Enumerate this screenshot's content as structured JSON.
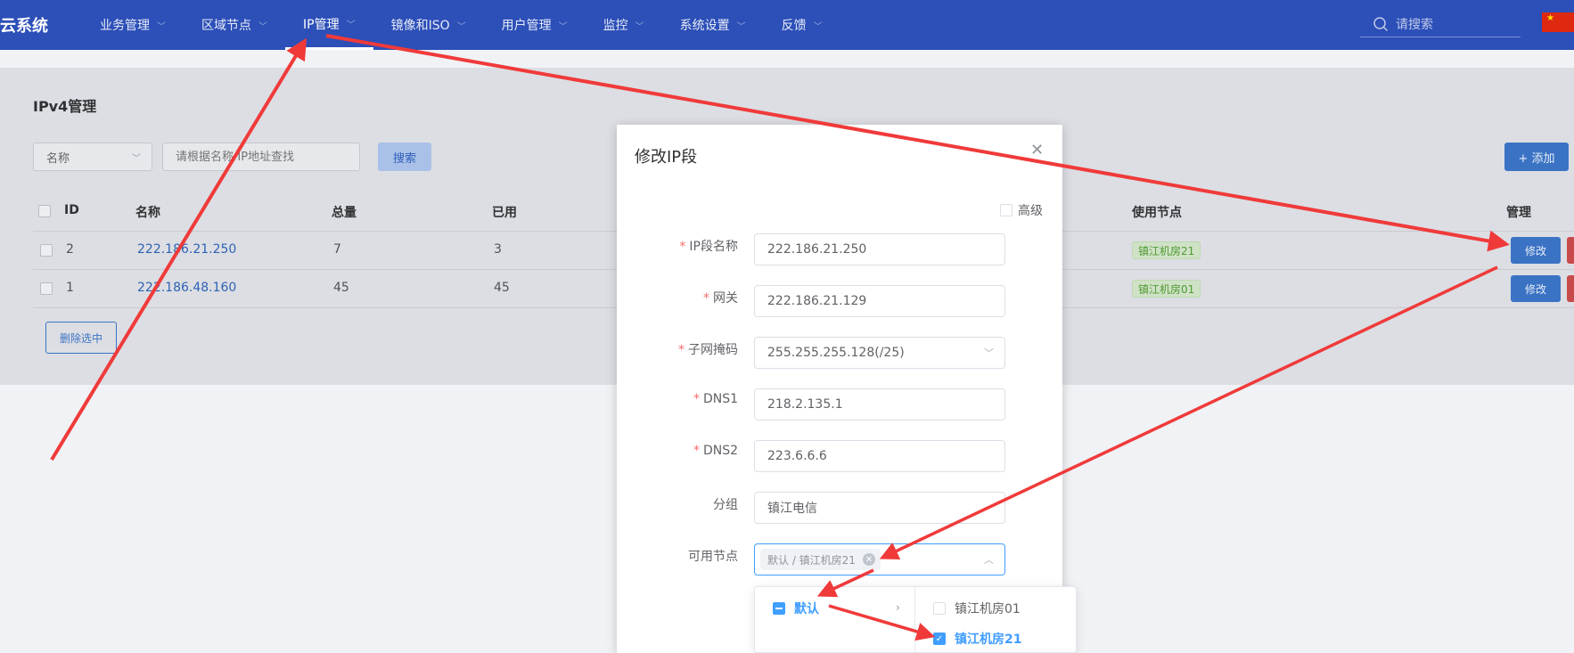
{
  "nav": {
    "brand": "云系统",
    "items": [
      {
        "label": "业务管理"
      },
      {
        "label": "区域节点"
      },
      {
        "label": "IP管理"
      },
      {
        "label": "镜像和ISO"
      },
      {
        "label": "用户管理"
      },
      {
        "label": "监控"
      },
      {
        "label": "系统设置"
      },
      {
        "label": "反馈"
      }
    ],
    "active_index": 2,
    "search_placeholder": "请搜索"
  },
  "page": {
    "title": "IPv4管理",
    "filter_select": "名称",
    "filter_placeholder": "请根据名称/IP地址查找",
    "search_button": "搜索",
    "add_button": "+ 添加",
    "batch_delete_button": "删除选中"
  },
  "table": {
    "headers": {
      "id": "ID",
      "name": "名称",
      "total": "总量",
      "used": "已用",
      "nodes": "使用节点",
      "manage": "管理"
    },
    "rows": [
      {
        "id": "2",
        "name": "222.186.21.250",
        "total": "7",
        "used": "3",
        "node": "镇江机房21",
        "edit": "修改"
      },
      {
        "id": "1",
        "name": "222.186.48.160",
        "total": "45",
        "used": "45",
        "node": "镇江机房01",
        "edit": "修改"
      }
    ]
  },
  "modal": {
    "title": "修改IP段",
    "advanced_label": "高级",
    "fields": {
      "ip_name": {
        "label": "IP段名称",
        "value": "222.186.21.250"
      },
      "gateway": {
        "label": "网关",
        "value": "222.186.21.129"
      },
      "netmask": {
        "label": "子网掩码",
        "value": "255.255.255.128(/25)"
      },
      "dns1": {
        "label": "DNS1",
        "value": "218.2.135.1"
      },
      "dns2": {
        "label": "DNS2",
        "value": "223.6.6.6"
      },
      "group": {
        "label": "分组",
        "value": "镇江电信"
      },
      "nodes": {
        "label": "可用节点",
        "chip": "默认 / 镇江机房21"
      }
    }
  },
  "cascader": {
    "level1": "默认",
    "level2": [
      {
        "label": "镇江机房01",
        "checked": false
      },
      {
        "label": "镇江机房21",
        "checked": true
      }
    ]
  },
  "colors": {
    "nav_bg": "#2c4fb8",
    "accent": "#409eff",
    "arrow": "#f03a3a"
  }
}
